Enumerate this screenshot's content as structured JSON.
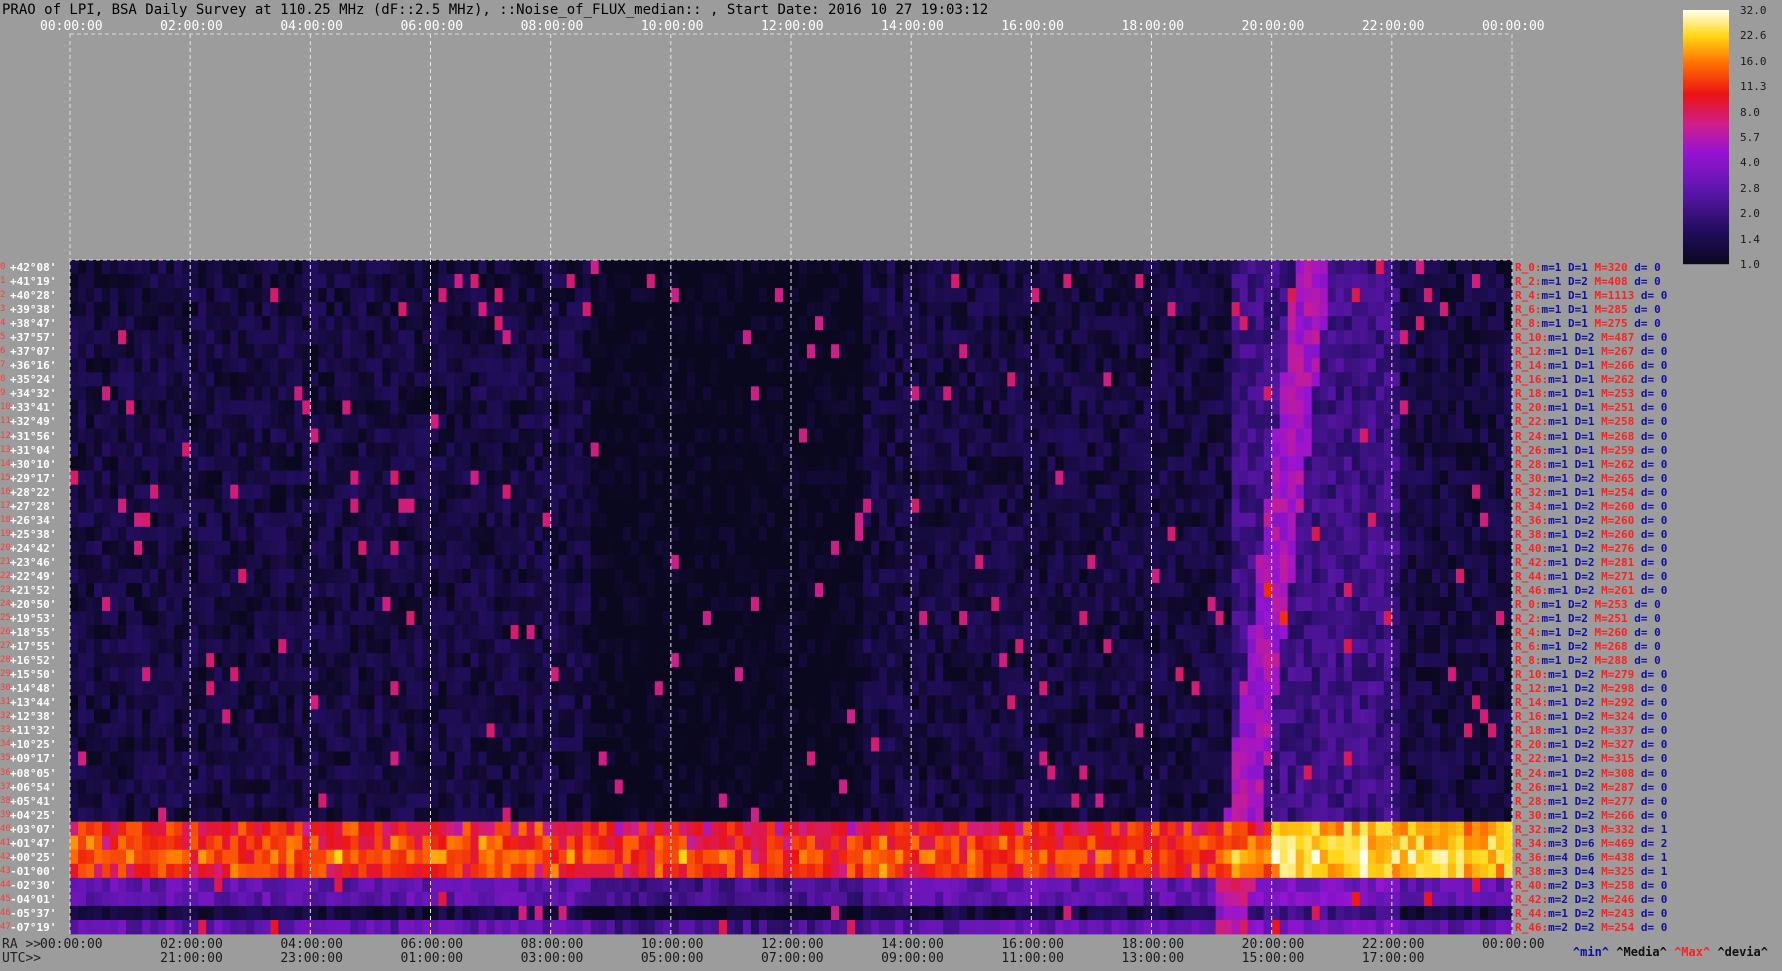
{
  "title": "PRAO of LPI, BSA Daily Survey at 110.25 MHz (dF::2.5 MHz), ::Noise_of_FLUX_median:: , Start Date: 2016 10 27 19:03:12",
  "axis": {
    "top_ticks": [
      "00:00:00",
      "02:00:00",
      "04:00:00",
      "06:00:00",
      "08:00:00",
      "10:00:00",
      "12:00:00",
      "14:00:00",
      "16:00:00",
      "18:00:00",
      "20:00:00",
      "22:00:00",
      "00:00:00"
    ],
    "ra_label": "RA >>",
    "ra_ticks": [
      "00:00:00",
      "02:00:00",
      "04:00:00",
      "06:00:00",
      "08:00:00",
      "10:00:00",
      "12:00:00",
      "14:00:00",
      "16:00:00",
      "18:00:00",
      "20:00:00",
      "22:00:00",
      "00:00:00"
    ],
    "utc_label": "UTC>>",
    "utc_ticks": [
      "21:00:00",
      "23:00:00",
      "01:00:00",
      "03:00:00",
      "05:00:00",
      "07:00:00",
      "09:00:00",
      "11:00:00",
      "13:00:00",
      "15:00:00",
      "17:00:00"
    ]
  },
  "colorbar": {
    "labels": [
      "32.0",
      "22.6",
      "16.0",
      "11.3",
      "8.0",
      "5.7",
      "4.0",
      "2.8",
      "2.0",
      "1.4",
      "1.0"
    ]
  },
  "legend": {
    "min": "^min^",
    "media": "^Media^",
    "max": "^Max^",
    "devia": "^devia^"
  },
  "colors": {
    "background": "#9c9c9c",
    "max_text": "#ff2020",
    "min_text": "#1010a0",
    "rowno": "#ff3a3a"
  },
  "chart_data": {
    "type": "heatmap",
    "title": "PRAO of LPI, BSA Daily Survey at 110.25 MHz (dF::2.5 MHz), ::Noise_of_FLUX_median:: , Start Date: 2016 10 27 19:03:12",
    "x_axis": "RA / UTC",
    "declinations": [
      "+42°08'",
      "+41°19'",
      "+40°28'",
      "+39°38'",
      "+38°47'",
      "+37°57'",
      "+37°07'",
      "+36°16'",
      "+35°24'",
      "+34°32'",
      "+33°41'",
      "+32°49'",
      "+31°56'",
      "+31°04'",
      "+30°10'",
      "+29°17'",
      "+28°22'",
      "+27°28'",
      "+26°34'",
      "+25°38'",
      "+24°42'",
      "+23°46'",
      "+22°49'",
      "+21°52'",
      "+20°50'",
      "+19°53'",
      "+18°55'",
      "+17°55'",
      "+16°52'",
      "+15°50'",
      "+14°48'",
      "+13°44'",
      "+12°38'",
      "+11°32'",
      "+10°25'",
      "+09°17'",
      "+08°05'",
      "+06°54'",
      "+05°41'",
      "+04°25'",
      "+03°07'",
      "+01°47'",
      "+00°25'",
      "-01°00'",
      "-02°30'",
      "-04°01'",
      "-05°37'",
      "-07°19'"
    ],
    "row_numbers": [
      "0",
      "1",
      "2",
      "3",
      "4",
      "5",
      "6",
      "7",
      "8",
      "9",
      "10",
      "11",
      "12",
      "13",
      "14",
      "15",
      "16",
      "17",
      "18",
      "19",
      "20",
      "21",
      "22",
      "23",
      "24",
      "25",
      "26",
      "27",
      "28",
      "29",
      "30",
      "31",
      "32",
      "33",
      "34",
      "35",
      "36",
      "37",
      "38",
      "39",
      "40",
      "41",
      "42",
      "43",
      "44",
      "45",
      "46",
      "47"
    ],
    "colorbar_range": [
      1.0,
      32.0
    ],
    "colorbar_scale": "log",
    "row_stats": [
      {
        "r": "R_0:",
        "m": "1",
        "d": "1",
        "mx": "320",
        "dv": "0"
      },
      {
        "r": "R_2:",
        "m": "1",
        "d": "2",
        "mx": "408",
        "dv": "0"
      },
      {
        "r": "R_4:",
        "m": "1",
        "d": "1",
        "mx": "1113",
        "dv": "0"
      },
      {
        "r": "R_6:",
        "m": "1",
        "d": "1",
        "mx": "285",
        "dv": "0"
      },
      {
        "r": "R_8:",
        "m": "1",
        "d": "1",
        "mx": "275",
        "dv": "0"
      },
      {
        "r": "R_10:",
        "m": "1",
        "d": "2",
        "mx": "487",
        "dv": "0"
      },
      {
        "r": "R_12:",
        "m": "1",
        "d": "1",
        "mx": "267",
        "dv": "0"
      },
      {
        "r": "R_14:",
        "m": "1",
        "d": "1",
        "mx": "266",
        "dv": "0"
      },
      {
        "r": "R_16:",
        "m": "1",
        "d": "1",
        "mx": "262",
        "dv": "0"
      },
      {
        "r": "R_18:",
        "m": "1",
        "d": "1",
        "mx": "253",
        "dv": "0"
      },
      {
        "r": "R_20:",
        "m": "1",
        "d": "1",
        "mx": "251",
        "dv": "0"
      },
      {
        "r": "R_22:",
        "m": "1",
        "d": "1",
        "mx": "258",
        "dv": "0"
      },
      {
        "r": "R_24:",
        "m": "1",
        "d": "1",
        "mx": "268",
        "dv": "0"
      },
      {
        "r": "R_26:",
        "m": "1",
        "d": "1",
        "mx": "259",
        "dv": "0"
      },
      {
        "r": "R_28:",
        "m": "1",
        "d": "1",
        "mx": "262",
        "dv": "0"
      },
      {
        "r": "R_30:",
        "m": "1",
        "d": "2",
        "mx": "265",
        "dv": "0"
      },
      {
        "r": "R_32:",
        "m": "1",
        "d": "1",
        "mx": "254",
        "dv": "0"
      },
      {
        "r": "R_34:",
        "m": "1",
        "d": "2",
        "mx": "260",
        "dv": "0"
      },
      {
        "r": "R_36:",
        "m": "1",
        "d": "2",
        "mx": "260",
        "dv": "0"
      },
      {
        "r": "R_38:",
        "m": "1",
        "d": "2",
        "mx": "260",
        "dv": "0"
      },
      {
        "r": "R_40:",
        "m": "1",
        "d": "2",
        "mx": "276",
        "dv": "0"
      },
      {
        "r": "R_42:",
        "m": "1",
        "d": "2",
        "mx": "281",
        "dv": "0"
      },
      {
        "r": "R_44:",
        "m": "1",
        "d": "2",
        "mx": "271",
        "dv": "0"
      },
      {
        "r": "R_46:",
        "m": "1",
        "d": "2",
        "mx": "261",
        "dv": "0"
      },
      {
        "r": "R_0:",
        "m": "1",
        "d": "2",
        "mx": "253",
        "dv": "0"
      },
      {
        "r": "R_2:",
        "m": "1",
        "d": "2",
        "mx": "251",
        "dv": "0"
      },
      {
        "r": "R_4:",
        "m": "1",
        "d": "2",
        "mx": "260",
        "dv": "0"
      },
      {
        "r": "R_6:",
        "m": "1",
        "d": "2",
        "mx": "268",
        "dv": "0"
      },
      {
        "r": "R_8:",
        "m": "1",
        "d": "2",
        "mx": "288",
        "dv": "0"
      },
      {
        "r": "R_10:",
        "m": "1",
        "d": "2",
        "mx": "279",
        "dv": "0"
      },
      {
        "r": "R_12:",
        "m": "1",
        "d": "2",
        "mx": "298",
        "dv": "0"
      },
      {
        "r": "R_14:",
        "m": "1",
        "d": "2",
        "mx": "292",
        "dv": "0"
      },
      {
        "r": "R_16:",
        "m": "1",
        "d": "2",
        "mx": "324",
        "dv": "0"
      },
      {
        "r": "R_18:",
        "m": "1",
        "d": "2",
        "mx": "337",
        "dv": "0"
      },
      {
        "r": "R_20:",
        "m": "1",
        "d": "2",
        "mx": "327",
        "dv": "0"
      },
      {
        "r": "R_22:",
        "m": "1",
        "d": "2",
        "mx": "315",
        "dv": "0"
      },
      {
        "r": "R_24:",
        "m": "1",
        "d": "2",
        "mx": "308",
        "dv": "0"
      },
      {
        "r": "R_26:",
        "m": "1",
        "d": "2",
        "mx": "287",
        "dv": "0"
      },
      {
        "r": "R_28:",
        "m": "1",
        "d": "2",
        "mx": "277",
        "dv": "0"
      },
      {
        "r": "R_30:",
        "m": "1",
        "d": "2",
        "mx": "266",
        "dv": "0"
      },
      {
        "r": "R_32:",
        "m": "2",
        "d": "3",
        "mx": "332",
        "dv": "1"
      },
      {
        "r": "R_34:",
        "m": "3",
        "d": "6",
        "mx": "469",
        "dv": "2"
      },
      {
        "r": "R_36:",
        "m": "4",
        "d": "6",
        "mx": "438",
        "dv": "1"
      },
      {
        "r": "R_38:",
        "m": "3",
        "d": "4",
        "mx": "325",
        "dv": "1"
      },
      {
        "r": "R_40:",
        "m": "2",
        "d": "3",
        "mx": "258",
        "dv": "0"
      },
      {
        "r": "R_42:",
        "m": "2",
        "d": "2",
        "mx": "246",
        "dv": "0"
      },
      {
        "r": "R_44:",
        "m": "1",
        "d": "2",
        "mx": "243",
        "dv": "0"
      },
      {
        "r": "R_46:",
        "m": "2",
        "d": "2",
        "mx": "254",
        "dv": "0"
      }
    ]
  }
}
